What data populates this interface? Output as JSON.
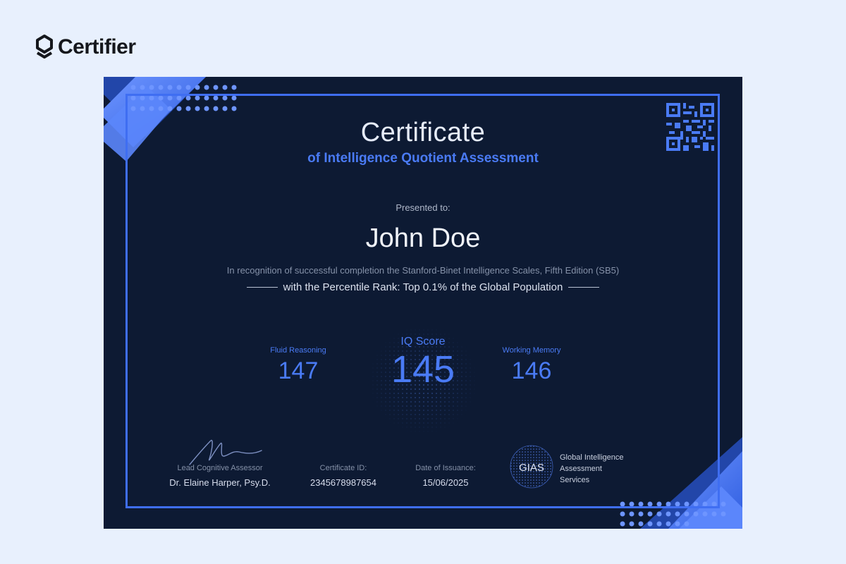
{
  "brand": {
    "name": "Certifier",
    "icon": "certifier-logo-icon"
  },
  "certificate": {
    "title": "Certificate",
    "subtitle": "of Intelligence Quotient Assessment",
    "presented_label": "Presented to:",
    "recipient_name": "John Doe",
    "recognition_text": "In recognition of successful completion the Stanford-Binet Intelligence Scales, Fifth Edition (SB5)",
    "rank_text": "with the Percentile Rank: Top 0.1% of the Global Population",
    "scores": {
      "fluid": {
        "label": "Fluid Reasoning",
        "value": "147"
      },
      "iq": {
        "label": "IQ Score",
        "value": "145"
      },
      "memory": {
        "label": "Working Memory",
        "value": "146"
      }
    },
    "footer": {
      "assessor_label": "Lead Cognitive Assessor",
      "assessor_name": "Dr. Elaine Harper, Psy.D.",
      "id_label": "Certificate ID:",
      "id_value": "2345678987654",
      "date_label": "Date of Issuance:",
      "date_value": "15/06/2025"
    },
    "issuer": {
      "abbr": "GIAS",
      "name_line1": "Global Intelligence",
      "name_line2": "Assessment",
      "name_line3": "Services"
    },
    "colors": {
      "accent": "#4a7bf5",
      "background": "#0d1a33",
      "frame": "#3f6ef2"
    }
  }
}
